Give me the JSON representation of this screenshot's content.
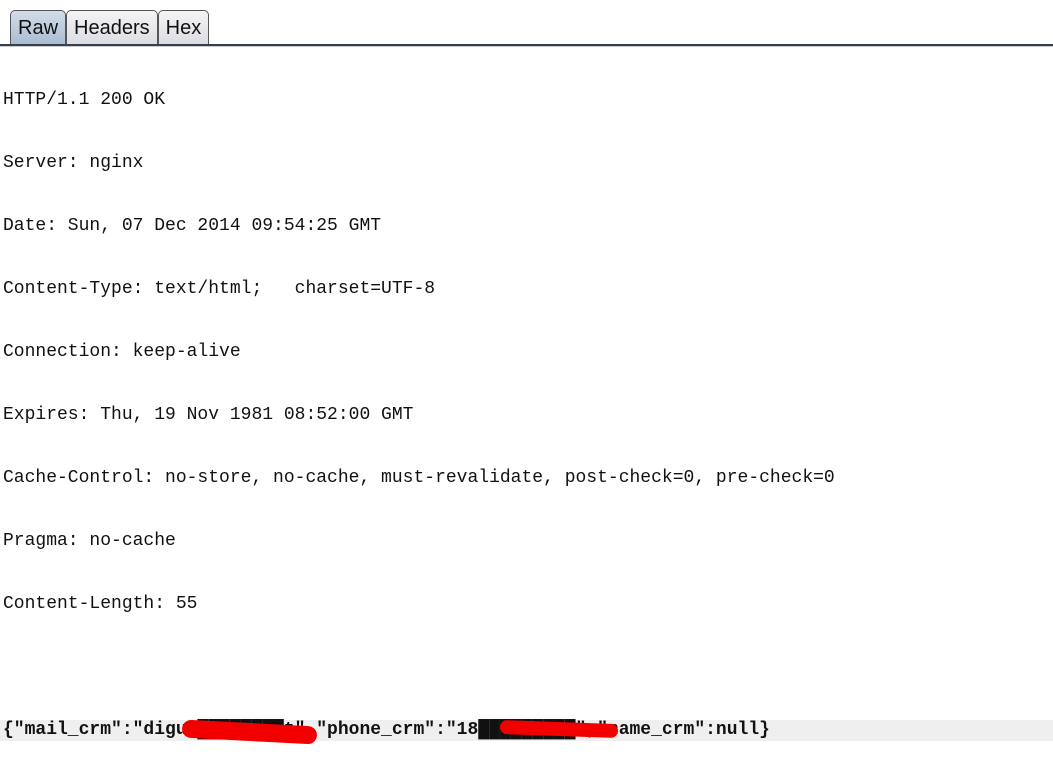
{
  "tabs": [
    {
      "label": "Raw",
      "selected": true
    },
    {
      "label": "Headers",
      "selected": false
    },
    {
      "label": "Hex",
      "selected": false
    }
  ],
  "response": {
    "lines": [
      "HTTP/1.1 200 OK",
      "Server: nginx",
      "Date: Sun, 07 Dec 2014 09:54:25 GMT",
      "Content-Type: text/html;   charset=UTF-8",
      "Connection: keep-alive",
      "Expires: Thu, 19 Nov 1981 08:52:00 GMT",
      "Cache-Control: no-store, no-cache, must-revalidate, post-check=0, pre-check=0",
      "Pragma: no-cache",
      "Content-Length: 55",
      ""
    ],
    "body": "{\"mail_crm\":\"diguo████████t\",\"phone_crm\":\"18█████████\",\"name_crm\":null}"
  },
  "colors": {
    "redaction": "#f20000",
    "selected_tab": "#a9bdd2"
  }
}
